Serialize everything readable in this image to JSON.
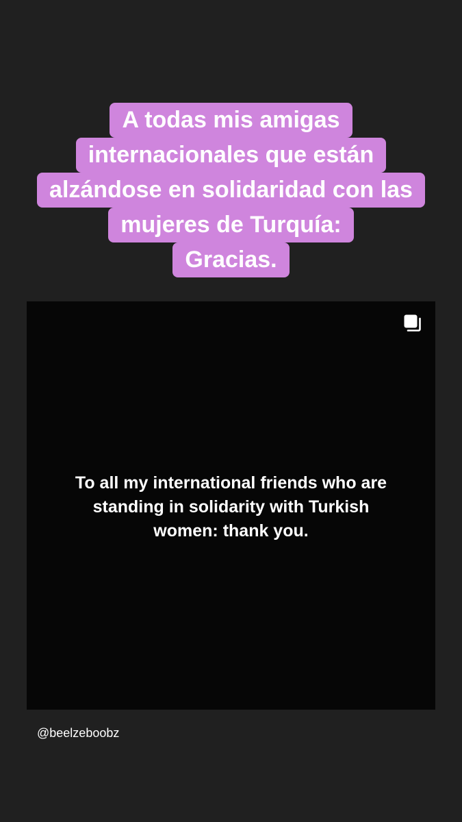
{
  "caption": {
    "lines": [
      "A todas mis amigas",
      "internacionales que están",
      "alzándose en solidaridad con las",
      "mujeres de Turquía:",
      "Gracias."
    ],
    "highlight_color": "#cf85dd"
  },
  "post": {
    "text_lines": [
      "To all my international friends who are",
      "standing in solidarity with Turkish",
      "women: thank you."
    ],
    "corner_icon": "multiple-images-icon"
  },
  "attribution": {
    "username": "@beelzeboobz"
  }
}
